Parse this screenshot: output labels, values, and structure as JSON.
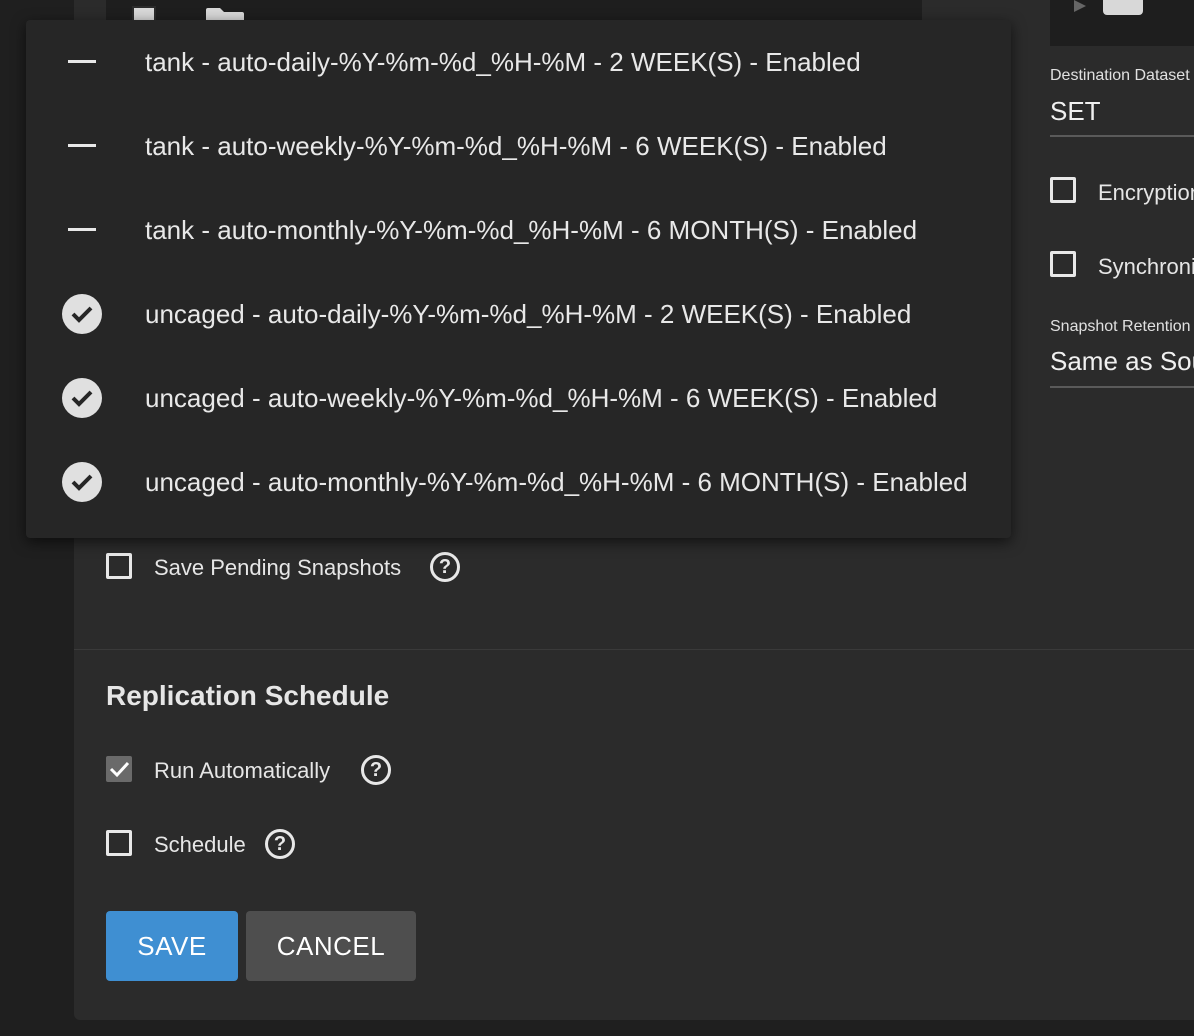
{
  "dropdown": {
    "options": [
      {
        "label": "tank - auto-daily-%Y-%m-%d_%H-%M - 2 WEEK(S) - Enabled",
        "selected": false
      },
      {
        "label": "tank - auto-weekly-%Y-%m-%d_%H-%M - 6 WEEK(S) - Enabled",
        "selected": false
      },
      {
        "label": "tank - auto-monthly-%Y-%m-%d_%H-%M - 6 MONTH(S) - Enabled",
        "selected": false
      },
      {
        "label": "uncaged - auto-daily-%Y-%m-%d_%H-%M - 2 WEEK(S) - Enabled",
        "selected": true
      },
      {
        "label": "uncaged - auto-weekly-%Y-%m-%d_%H-%M - 6 WEEK(S) - Enabled",
        "selected": true
      },
      {
        "label": "uncaged - auto-monthly-%Y-%m-%d_%H-%M - 6 MONTH(S) - Enabled",
        "selected": true
      }
    ]
  },
  "destination": {
    "dataset_label": "Destination Dataset",
    "dataset_value": "SET",
    "encryption_label": "Encryption",
    "synchronize_label": "Synchronize",
    "retention_label": "Snapshot Retention",
    "retention_value": "Same as Source"
  },
  "source": {
    "save_pending_label": "Save Pending Snapshots"
  },
  "schedule": {
    "title": "Replication Schedule",
    "run_auto_label": "Run Automatically",
    "run_auto_checked": true,
    "schedule_label": "Schedule",
    "schedule_checked": false
  },
  "actions": {
    "save_label": "SAVE",
    "cancel_label": "CANCEL"
  },
  "icons": {
    "help": "help-circle-icon",
    "check": "check-circle-icon",
    "dash": "dash-icon",
    "folder": "folder-icon"
  },
  "colors": {
    "accent": "#3f8fd2",
    "panel": "#2b2b2b",
    "dropdown": "#262626"
  }
}
